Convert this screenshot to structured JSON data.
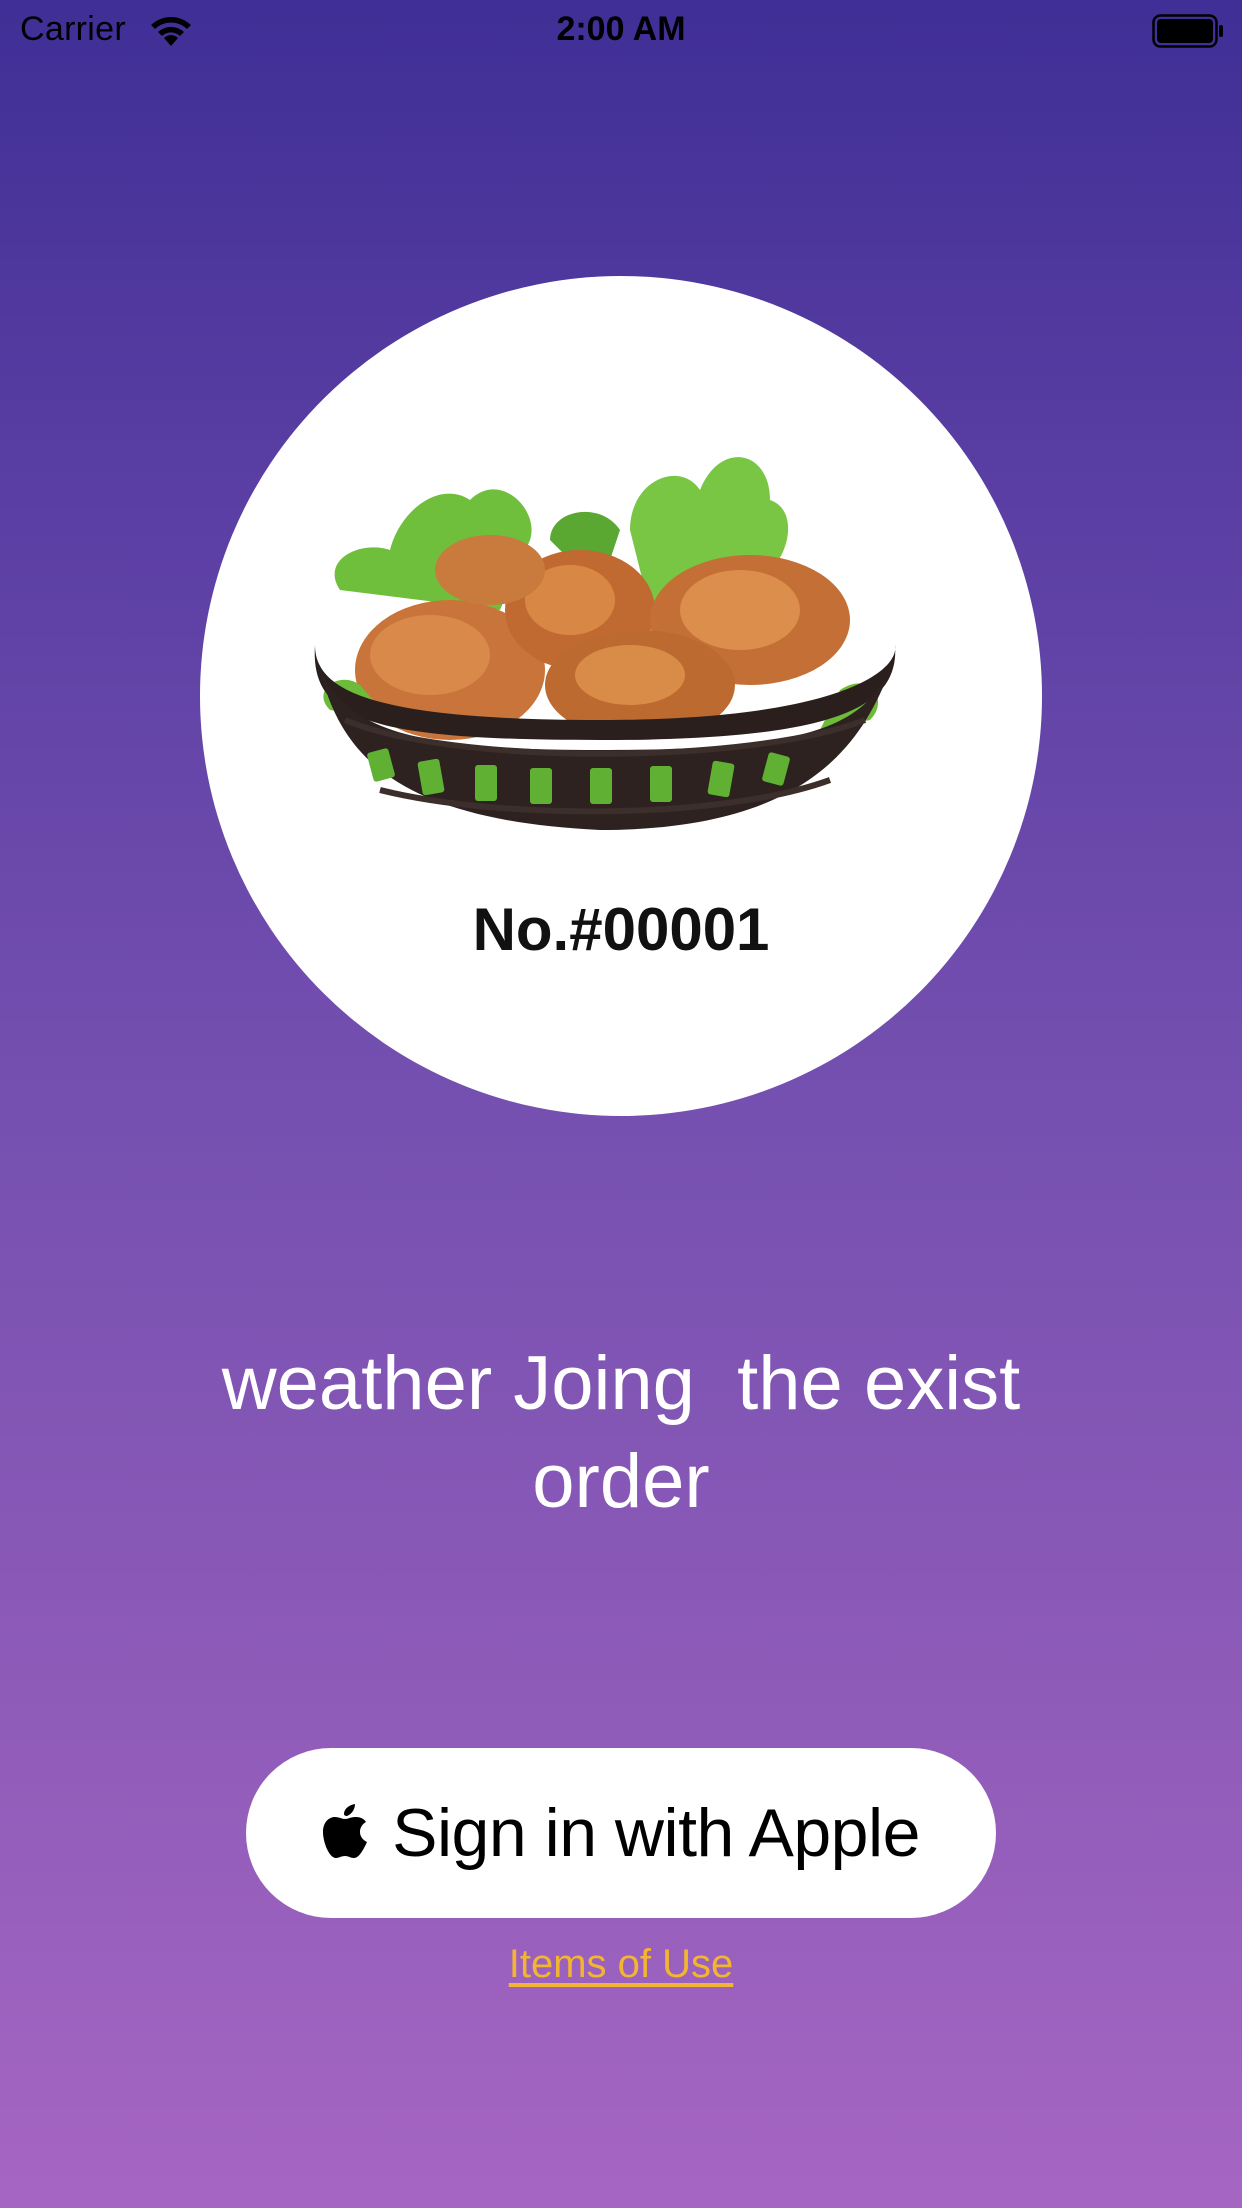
{
  "status_bar": {
    "carrier": "Carrier",
    "time": "2:00 AM",
    "icons": [
      "wifi-icon",
      "battery-icon"
    ]
  },
  "hero": {
    "image": "fried-chicken-basket",
    "order_number": "No.#00001"
  },
  "prompt": {
    "text": "weather Joing  the exist\norder"
  },
  "actions": {
    "apple_sign_in_label": "Sign in with Apple",
    "terms_link_label": "Items of Use"
  },
  "colors": {
    "gradient_top": "#3f2f96",
    "gradient_bottom": "#a566c2",
    "link": "#f2b531",
    "button_bg": "#ffffff"
  }
}
